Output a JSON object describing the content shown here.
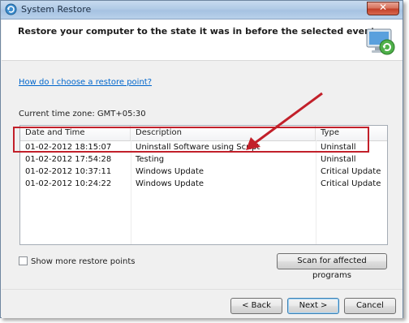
{
  "window": {
    "title": "System Restore"
  },
  "header": {
    "heading": "Restore your computer to the state it was in before the selected event"
  },
  "help_link": "How do I choose a restore point?",
  "timezone": "Current time zone: GMT+05:30",
  "table": {
    "columns": [
      "Date and Time",
      "Description",
      "Type"
    ],
    "rows": [
      {
        "date": "01-02-2012 18:15:07",
        "description": "Uninstall Software using Script",
        "type": "Uninstall"
      },
      {
        "date": "01-02-2012 17:54:28",
        "description": "Testing",
        "type": "Uninstall"
      },
      {
        "date": "01-02-2012 10:37:11",
        "description": "Windows Update",
        "type": "Critical Update"
      },
      {
        "date": "01-02-2012 10:24:22",
        "description": "Windows Update",
        "type": "Critical Update"
      }
    ]
  },
  "checkbox": {
    "label": "Show more restore points",
    "checked": false
  },
  "buttons": {
    "scan": "Scan for affected programs",
    "back": "< Back",
    "next": "Next >",
    "cancel": "Cancel"
  },
  "close_glyph": "✕",
  "colors": {
    "annotation": "#c2202a",
    "link": "#0066cc"
  },
  "icons": {
    "app": "system-restore-icon",
    "hero": "restore-monitor-icon"
  }
}
